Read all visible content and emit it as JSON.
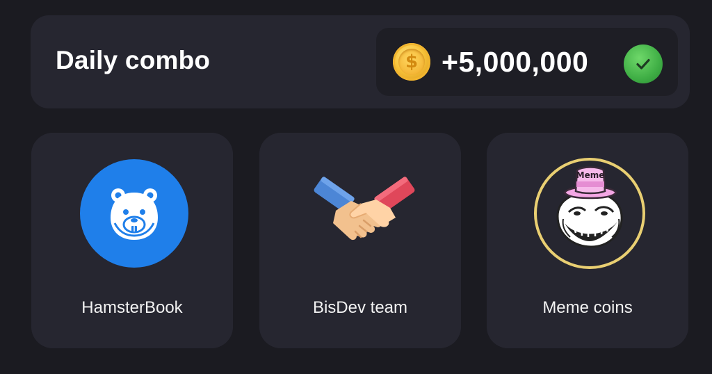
{
  "header": {
    "title": "Daily combo",
    "reward_amount": "+5,000,000",
    "coin_symbol": "$"
  },
  "cards": [
    {
      "label": "HamsterBook",
      "icon": "hamster-face-icon",
      "completed": true
    },
    {
      "label": "BisDev team",
      "icon": "handshake-icon",
      "completed": true
    },
    {
      "label": "Meme coins",
      "icon": "trollface-meme-hat-icon",
      "hat_text": "Meme",
      "completed": true
    }
  ],
  "colors": {
    "background": "#1b1b21",
    "panel": "#262630",
    "card_border": "#4fb85c",
    "hamster_blue": "#1f7fea",
    "check_green": "#3fae45",
    "coin_gold": "#f7c33a",
    "meme_ring": "#e9cf72",
    "hat_pink": "#f3a6e4"
  }
}
